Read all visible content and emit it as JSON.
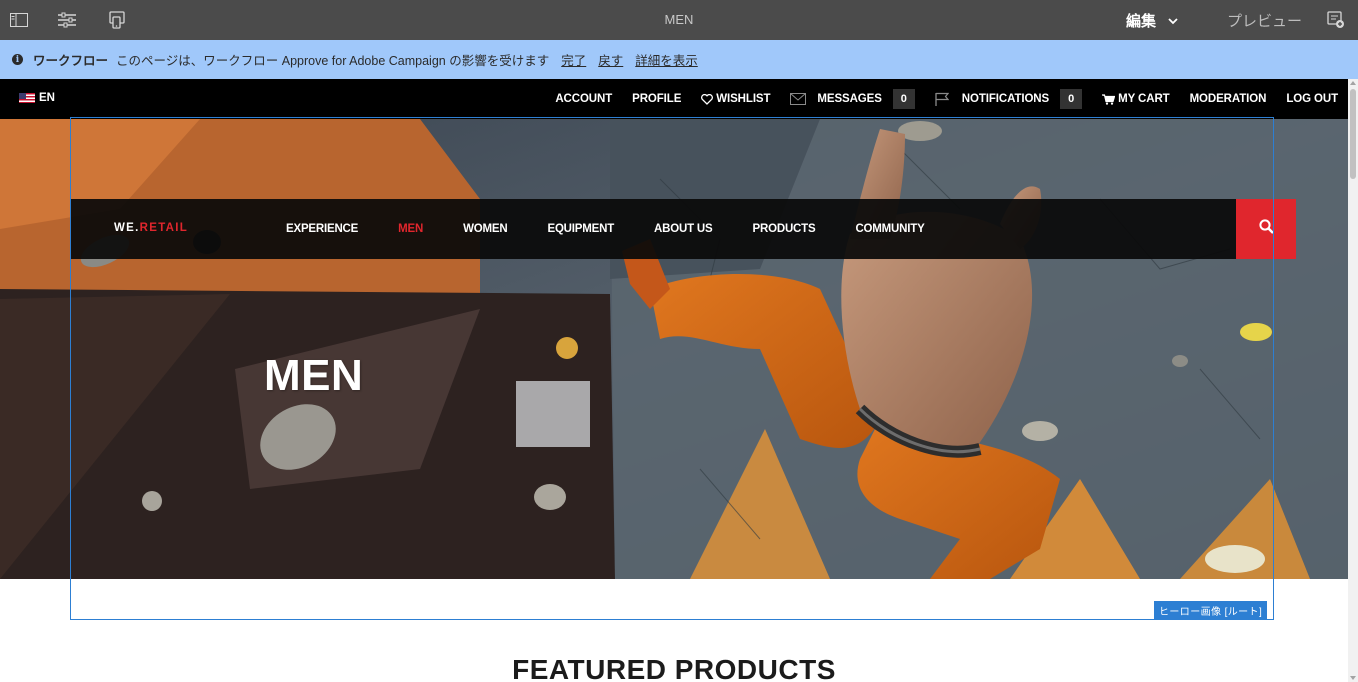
{
  "editor": {
    "title": "MEN",
    "mode": "編集",
    "preview": "プレビュー"
  },
  "workflow": {
    "label": "ワークフロー",
    "message": "このページは、ワークフロー Approve for Adobe Campaign の影響を受けます",
    "actions": [
      "完了",
      "戻す",
      "詳細を表示"
    ]
  },
  "util_nav": {
    "language": "EN",
    "account": "ACCOUNT",
    "profile": "PROFILE",
    "wishlist": "WISHLIST",
    "messages": "MESSAGES",
    "messages_count": "0",
    "notifications": "NOTIFICATIONS",
    "notifications_count": "0",
    "cart": "MY CART",
    "moderation": "MODERATION",
    "logout": "LOG OUT"
  },
  "main_nav": {
    "brand_a": "WE.",
    "brand_b": "RETAIL",
    "items": [
      "EXPERIENCE",
      "MEN",
      "WOMEN",
      "EQUIPMENT",
      "ABOUT US",
      "PRODUCTS",
      "COMMUNITY"
    ],
    "active_item": "MEN"
  },
  "hero": {
    "title": "MEN"
  },
  "selection": {
    "component_label": "ヒーロー画像 [ルート]"
  },
  "featured": {
    "heading": "FEATURED PRODUCTS"
  },
  "colors": {
    "brand_red": "#e0262d",
    "selection_blue": "#2d7fd3",
    "workflow_bar": "#a0c8fa",
    "editor_bar": "#4b4b4b"
  }
}
